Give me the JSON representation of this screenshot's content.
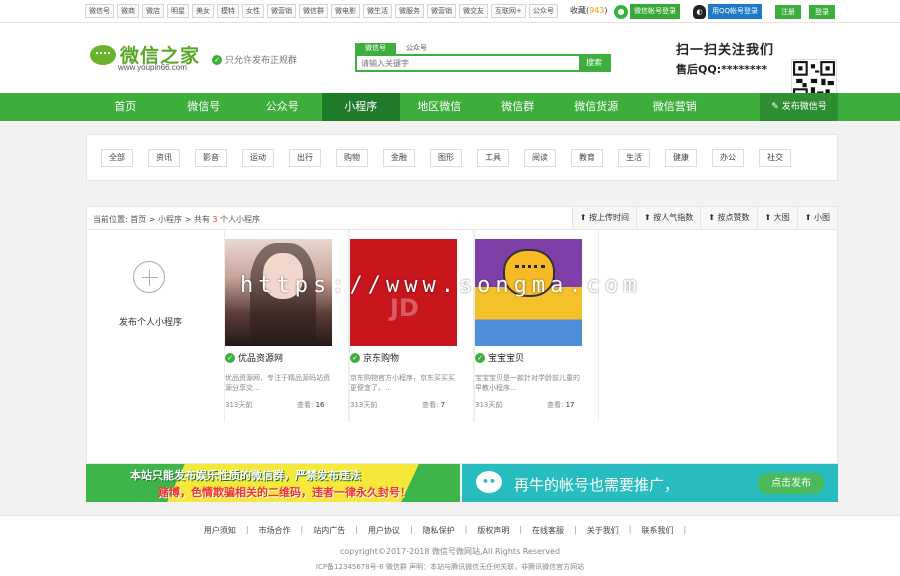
{
  "topbar": {
    "links": [
      "微信号",
      "微商",
      "微店",
      "明星",
      "美女",
      "模特",
      "女性",
      "微营销",
      "微信群",
      "微电影",
      "微生活",
      "微服务",
      "微营销",
      "微交友",
      "互联网+",
      "公众号"
    ],
    "favorites_label": "收藏",
    "favorites_count": "943",
    "wx_login": "微信帐号登录",
    "qq_login": "用QQ帐号登录",
    "register": "注册",
    "login": "登录"
  },
  "header": {
    "logo_title": "微信之家",
    "logo_url": "www.youpin66.com",
    "slogan": "只允许发布正规群",
    "search_tabs": [
      "微信号",
      "公众号"
    ],
    "search_placeholder": "请输入关键字",
    "search_button": "搜索",
    "follow_text": "扫一扫关注我们",
    "qq_text": "售后QQ:********"
  },
  "nav": {
    "items": [
      "首页",
      "微信号",
      "公众号",
      "小程序",
      "地区微信",
      "微信群",
      "微信货源",
      "微信营销"
    ],
    "active": "小程序",
    "publish": "发布微信号"
  },
  "categories": [
    "全部",
    "资讯",
    "影音",
    "运动",
    "出行",
    "购物",
    "金融",
    "图形",
    "工具",
    "阅读",
    "教育",
    "生活",
    "健康",
    "办公",
    "社交"
  ],
  "listing": {
    "breadcrumb": "当前位置: 首页 > 小程序 > 共有",
    "count": "3",
    "count_suffix": "个人小程序",
    "sorts": [
      "按上传时间",
      "按人气指数",
      "按点赞数",
      "大图",
      "小图"
    ],
    "publish_label": "发布个人小程序",
    "cards": [
      {
        "name": "优品资源网",
        "desc": "优品资源网，专注于精品源码站资源分享交...",
        "days": "313天前",
        "views_label": "查看:",
        "views": "16"
      },
      {
        "name": "京东购物",
        "desc": "京东购物官方小程序，京东买买买更便宜了。...",
        "days": "313天前",
        "views_label": "查看:",
        "views": "7"
      },
      {
        "name": "宝宝宝贝",
        "desc": "宝宝宝贝是一款针对学龄前儿童的早教小程序...",
        "days": "313天前",
        "views_label": "查看:",
        "views": "17"
      }
    ]
  },
  "banners": {
    "left_line1": "本站只能发布娱乐性质的微信群，严禁发布违法",
    "left_line2": "赌博，色情欺骗相关的二维码，违者一律永久封号！",
    "right_text": "再牛的帐号也需要推广，",
    "right_button": "点击发布"
  },
  "footer": {
    "links": [
      "用户须知",
      "市场合作",
      "站内广告",
      "用户协议",
      "隐私保护",
      "版权声明",
      "在线客服",
      "关于我们",
      "联系我们"
    ],
    "copyright": "copyright©2017-2018 微信号微网站,All Rights Reserved",
    "icp": "ICP备12345678号-6 微信群 声明：本站与腾讯微信无任何关联，非腾讯微信官方网站"
  },
  "watermark": "https://www.songma.com",
  "colors": {
    "brand_green": "#3dae3c",
    "nav_active": "#1f7a2a",
    "banner_teal": "#27bcbd"
  }
}
